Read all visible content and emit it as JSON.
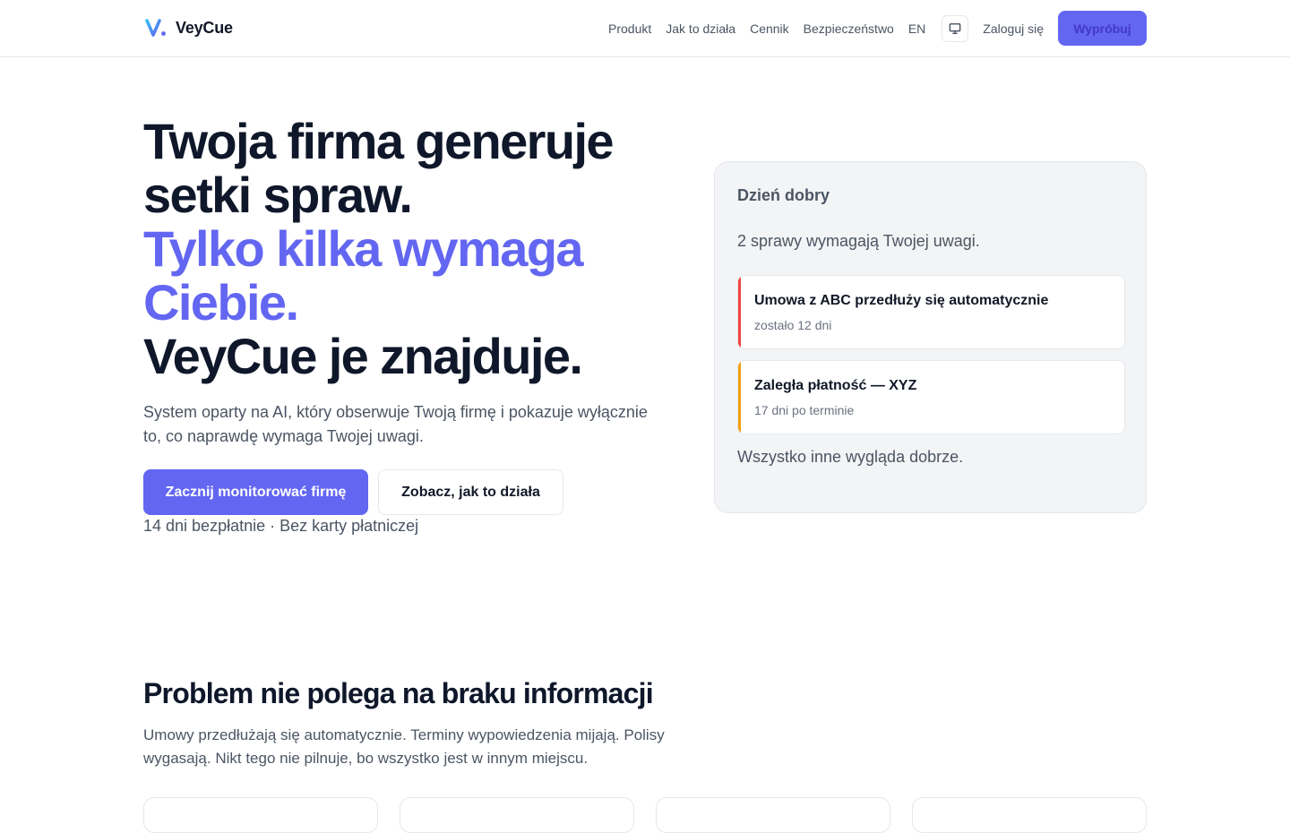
{
  "brand": {
    "name": "VeyCue",
    "logo_icon": "v-check-logo-icon",
    "accent_color": "#6366f1"
  },
  "nav": {
    "links": [
      "Produkt",
      "Jak to działa",
      "Cennik",
      "Bezpieczeństwo",
      "EN"
    ],
    "monitor_icon": "monitor-icon",
    "login_label": "Zaloguj się",
    "try_label": "Wypróbuj"
  },
  "hero": {
    "title_line1": "Twoja firma generuje",
    "title_line2": "setki spraw.",
    "title_accent_line1": "Tylko kilka wymaga",
    "title_accent_line2": "Ciebie.",
    "title_line3": "VeyCue je znajduje.",
    "subtitle": "System oparty na AI, który obserwuje Twoją firmę i pokazuje wyłącznie to, co naprawdę wymaga Twojej uwagi.",
    "primary_cta": "Zacznij monitorować firmę",
    "secondary_cta": "Zobacz, jak to działa",
    "note": "14 dni bezpłatnie · Bez karty płatniczej"
  },
  "summary_card": {
    "greeting": "Dzień dobry",
    "count_text": "2 sprawy wymagają Twojej uwagi.",
    "issues": [
      {
        "title": "Umowa z ABC przedłuży się automatycznie",
        "meta": "zostało 12 dni",
        "color": "#ef4444"
      },
      {
        "title": "Zaległa płatność — XYZ",
        "meta": "17 dni po terminie",
        "color": "#f59e0b"
      }
    ],
    "footer": "Wszystko inne wygląda dobrze."
  },
  "problem_section": {
    "title": "Problem nie polega na braku informacji",
    "text": "Umowy przedłużają się automatycznie. Terminy wypowiedzenia mijają. Polisy wygasają. Nikt tego nie pilnuje, bo wszystko jest w innym miejscu."
  }
}
